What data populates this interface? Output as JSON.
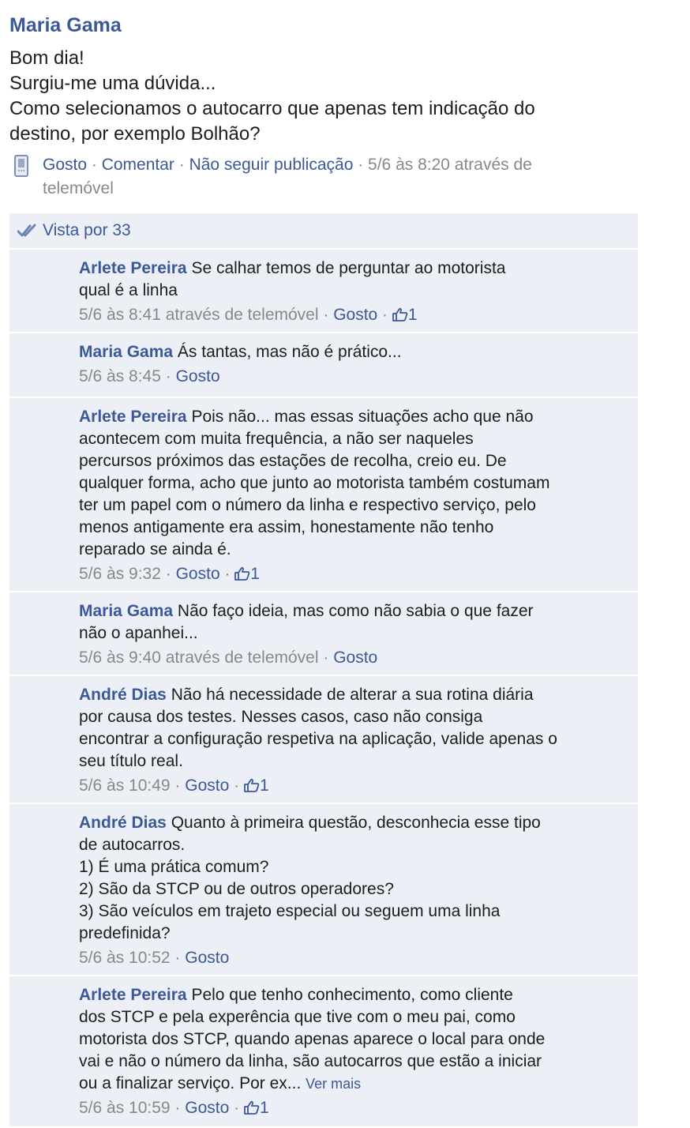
{
  "post": {
    "author": "Maria Gama",
    "lines": [
      "Bom dia!",
      "Surgiu-me uma dúvida...",
      "Como selecionamos o autocarro que apenas tem indicação do",
      "destino, por exemplo Bolhão?"
    ],
    "actions": {
      "like": "Gosto",
      "comment": "Comentar",
      "unfollow": "Não seguir publicação",
      "separator": " · ",
      "timestamp": "5/6 às 8:20 através de",
      "timestamp_cont": "telemóvel"
    }
  },
  "seen": {
    "label": "Vista por 33"
  },
  "comments": [
    {
      "author": "Arlete Pereira",
      "lines": [
        "Se calhar temos de perguntar ao motorista",
        "qual é a linha"
      ],
      "time": "5/6 às 8:41 através de telemóvel",
      "like": "Gosto",
      "likes": "1"
    },
    {
      "author": "Maria Gama",
      "lines": [
        "Ás tantas, mas não é prático..."
      ],
      "time": "5/6 às 8:45",
      "like": "Gosto",
      "likes": ""
    },
    {
      "author": "Arlete Pereira",
      "lines": [
        "Pois não... mas essas situações acho que não",
        "acontecem com muita frequência, a não ser naqueles",
        "percursos próximos das estações de recolha, creio eu. De",
        "qualquer forma, acho que junto ao motorista também costumam",
        "ter um papel com o número da linha e respectivo serviço, pelo",
        "menos antigamente era assim, honestamente não tenho",
        "reparado se ainda é."
      ],
      "time": "5/6 às 9:32",
      "like": "Gosto",
      "likes": "1"
    },
    {
      "author": "Maria Gama",
      "lines": [
        "Não faço ideia, mas como não sabia o que fazer",
        "não o apanhei..."
      ],
      "time": "5/6 às 9:40 através de telemóvel",
      "like": "Gosto",
      "likes": ""
    },
    {
      "author": "André Dias",
      "lines": [
        "Não há necessidade de alterar a sua rotina diária",
        "por causa dos testes. Nesses casos, caso não consiga",
        "encontrar a configuração respetiva na aplicação, valide apenas o",
        "seu título real."
      ],
      "time": "5/6 às 10:49",
      "like": "Gosto",
      "likes": "1"
    },
    {
      "author": "André Dias",
      "lines": [
        "Quanto à primeira questão, desconhecia esse tipo",
        "de autocarros.",
        "1) É uma prática comum?",
        "2) São da STCP ou de outros operadores?",
        "3) São veículos em trajeto especial ou seguem uma linha",
        "predefinida?"
      ],
      "time": "5/6 às 10:52",
      "like": "Gosto",
      "likes": ""
    },
    {
      "author": "Arlete Pereira",
      "lines": [
        "Pelo que tenho conhecimento, como cliente",
        "dos STCP e pela experência que tive com o meu pai, como",
        "motorista dos STCP, quando apenas aparece o local para onde",
        "vai e não o número da linha, são autocarros que estão a iniciar",
        "ou a finalizar serviço. Por ex..."
      ],
      "see_more": "Ver mais",
      "time": "5/6 às 10:59",
      "like": "Gosto",
      "likes": "1"
    }
  ],
  "colors": {
    "link": "#3b5998",
    "meta": "#888888",
    "thread_bg": "#eceff5"
  }
}
